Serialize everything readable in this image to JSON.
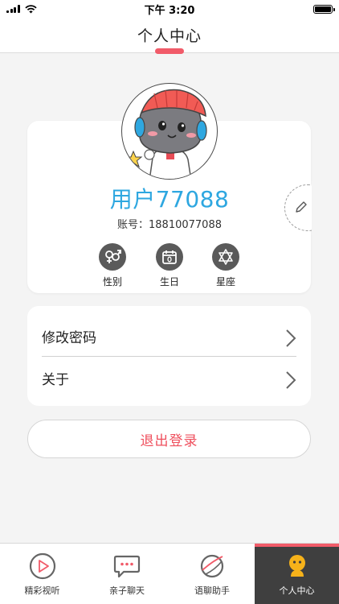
{
  "status_bar": {
    "time": "下午 3:20"
  },
  "nav": {
    "title": "个人中心"
  },
  "profile": {
    "name": "用户77088",
    "account": "账号：18810077088",
    "attributes": [
      {
        "label": "性别",
        "icon": "gender-icon"
      },
      {
        "label": "生日",
        "icon": "calendar-icon"
      },
      {
        "label": "星座",
        "icon": "star-of-david-icon"
      }
    ]
  },
  "menu": {
    "items": [
      {
        "label": "修改密码"
      },
      {
        "label": "关于"
      }
    ]
  },
  "logout": {
    "label": "退出登录"
  },
  "tabs": [
    {
      "label": "精彩视听",
      "icon": "play-circle-icon",
      "active": false
    },
    {
      "label": "亲子聊天",
      "icon": "chat-bubble-icon",
      "active": false
    },
    {
      "label": "语聊助手",
      "icon": "planet-icon",
      "active": false
    },
    {
      "label": "个人中心",
      "icon": "person-icon",
      "active": true
    }
  ],
  "colors": {
    "accent": "#f15b69",
    "name_blue": "#2ea7e0",
    "logout_red": "#ef4f5d",
    "active_tab_bg": "#3f3f3f",
    "active_icon_yellow": "#f6b21a"
  }
}
